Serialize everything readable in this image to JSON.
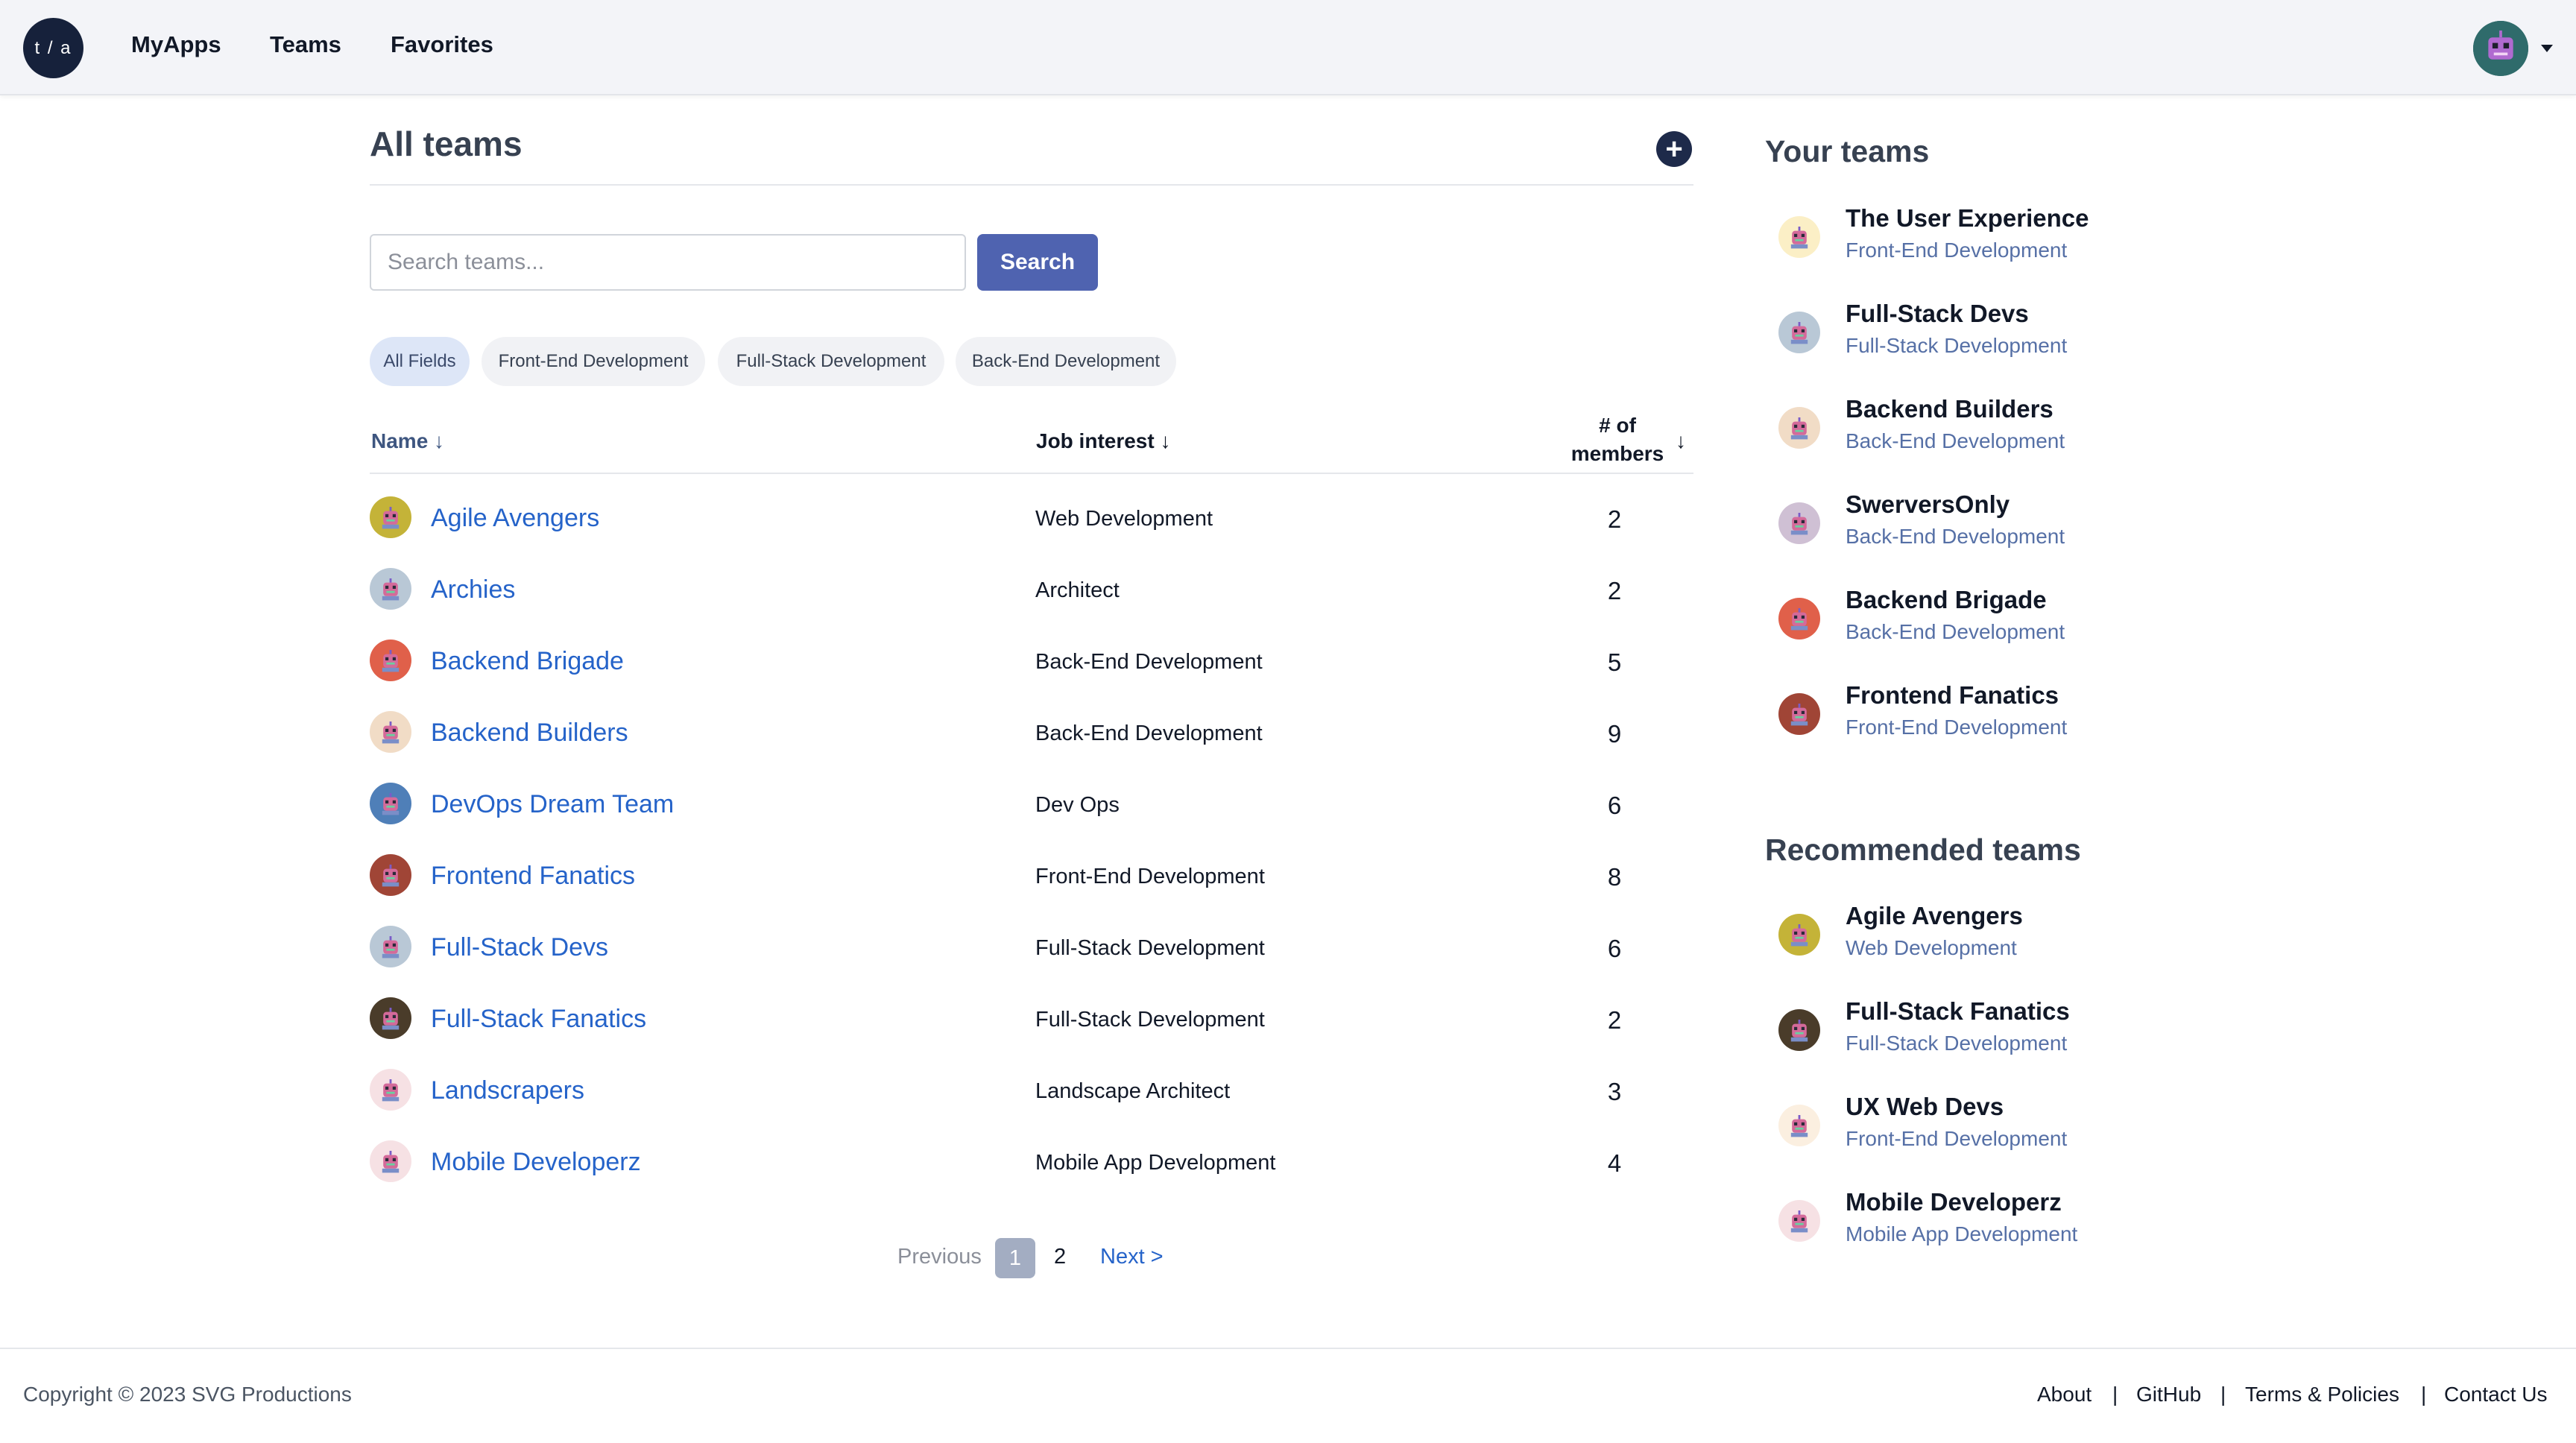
{
  "nav": {
    "logo_text": "t / a",
    "links": [
      "MyApps",
      "Teams",
      "Favorites"
    ],
    "avatar_color": "#2f6b6b"
  },
  "main": {
    "title": "All teams",
    "add_label": "+",
    "search": {
      "placeholder": "Search teams...",
      "button_label": "Search"
    },
    "filters": [
      "All Fields",
      "Front-End Development",
      "Full-Stack Development",
      "Back-End Development"
    ],
    "active_filter": "All Fields",
    "columns": {
      "name": "Name ↓",
      "job": "Job interest ↓",
      "members_line1": "# of",
      "members_line2": "members",
      "members_sort": "↓"
    },
    "rows": [
      {
        "name": "Agile Avengers",
        "job": "Web Development",
        "members": 2,
        "color": "#c4b338"
      },
      {
        "name": "Archies",
        "job": "Architect",
        "members": 2,
        "color": "#b9c8d6"
      },
      {
        "name": "Backend Brigade",
        "job": "Back-End Development",
        "members": 5,
        "color": "#e0604a"
      },
      {
        "name": "Backend Builders",
        "job": "Back-End Development",
        "members": 9,
        "color": "#f1dcc6"
      },
      {
        "name": "DevOps Dream Team",
        "job": "Dev Ops",
        "members": 6,
        "color": "#4f7fb8"
      },
      {
        "name": "Frontend Fanatics",
        "job": "Front-End Development",
        "members": 8,
        "color": "#a04536"
      },
      {
        "name": "Full-Stack Devs",
        "job": "Full-Stack Development",
        "members": 6,
        "color": "#b9c8d6"
      },
      {
        "name": "Full-Stack Fanatics",
        "job": "Full-Stack Development",
        "members": 2,
        "color": "#4a3c2a"
      },
      {
        "name": "Landscrapers",
        "job": "Landscape Architect",
        "members": 3,
        "color": "#f6e1e4"
      },
      {
        "name": "Mobile Developerz",
        "job": "Mobile App Development",
        "members": 4,
        "color": "#f6e1e4"
      }
    ],
    "pagination": {
      "prev": "Previous",
      "current": "1",
      "other": "2",
      "next": "Next >"
    }
  },
  "sidebar": {
    "your_title": "Your teams",
    "your_teams": [
      {
        "name": "The User Experience",
        "field": "Front-End Development",
        "color": "#fbefc6"
      },
      {
        "name": "Full-Stack Devs",
        "field": "Full-Stack Development",
        "color": "#b9c8d6"
      },
      {
        "name": "Backend Builders",
        "field": "Back-End Development",
        "color": "#f1dcc6"
      },
      {
        "name": "SwerversOnly",
        "field": "Back-End Development",
        "color": "#cfc0d4"
      },
      {
        "name": "Backend Brigade",
        "field": "Back-End Development",
        "color": "#e0604a"
      },
      {
        "name": "Frontend Fanatics",
        "field": "Front-End Development",
        "color": "#a04536"
      }
    ],
    "rec_title": "Recommended teams",
    "recommended": [
      {
        "name": "Agile Avengers",
        "field": "Web Development",
        "color": "#c4b338"
      },
      {
        "name": "Full-Stack Fanatics",
        "field": "Full-Stack Development",
        "color": "#4a3c2a"
      },
      {
        "name": "UX Web Devs",
        "field": "Front-End Development",
        "color": "#fbefe0"
      },
      {
        "name": "Mobile Developerz",
        "field": "Mobile App Development",
        "color": "#f6e1e4"
      }
    ]
  },
  "footer": {
    "copyright": "Copyright © 2023 SVG Productions",
    "links": [
      "About",
      "GitHub",
      "Terms & Policies",
      "Contact Us"
    ],
    "separator": "|"
  }
}
